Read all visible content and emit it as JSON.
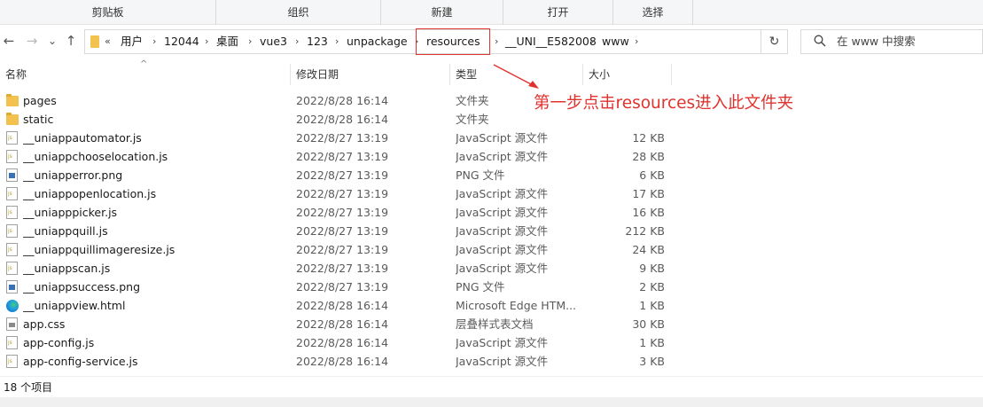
{
  "ribbon": {
    "groups": [
      "剪贴板",
      "组织",
      "新建",
      "打开",
      "选择"
    ]
  },
  "nav": {
    "back": "←",
    "forward": "→",
    "recent": "⌄",
    "up": "↑"
  },
  "address": {
    "overflow": "«",
    "crumbs": [
      "用户",
      "12044",
      "桌面",
      "vue3",
      "123",
      "unpackage",
      "resources",
      "__UNI__E582008",
      "www"
    ],
    "separator": "›",
    "highlight_color": "#e0332e"
  },
  "search": {
    "placeholder": "在 www 中搜索"
  },
  "columns": {
    "name": "名称",
    "date": "修改日期",
    "type": "类型",
    "size": "大小"
  },
  "files": [
    {
      "name": "pages",
      "date": "2022/8/28 16:14",
      "type": "文件夹",
      "size": "",
      "icon": "folder-icon"
    },
    {
      "name": "static",
      "date": "2022/8/28 16:14",
      "type": "文件夹",
      "size": "",
      "icon": "folder-icon"
    },
    {
      "name": "__uniappautomator.js",
      "date": "2022/8/27 13:19",
      "type": "JavaScript 源文件",
      "size": "12 KB",
      "icon": "js-file-icon"
    },
    {
      "name": "__uniappchooselocation.js",
      "date": "2022/8/27 13:19",
      "type": "JavaScript 源文件",
      "size": "28 KB",
      "icon": "js-file-icon"
    },
    {
      "name": "__uniapperror.png",
      "date": "2022/8/27 13:19",
      "type": "PNG 文件",
      "size": "6 KB",
      "icon": "png-file-icon"
    },
    {
      "name": "__uniappopenlocation.js",
      "date": "2022/8/27 13:19",
      "type": "JavaScript 源文件",
      "size": "17 KB",
      "icon": "js-file-icon"
    },
    {
      "name": "__uniapppicker.js",
      "date": "2022/8/27 13:19",
      "type": "JavaScript 源文件",
      "size": "16 KB",
      "icon": "js-file-icon"
    },
    {
      "name": "__uniappquill.js",
      "date": "2022/8/27 13:19",
      "type": "JavaScript 源文件",
      "size": "212 KB",
      "icon": "js-file-icon"
    },
    {
      "name": "__uniappquillimageresize.js",
      "date": "2022/8/27 13:19",
      "type": "JavaScript 源文件",
      "size": "24 KB",
      "icon": "js-file-icon"
    },
    {
      "name": "__uniappscan.js",
      "date": "2022/8/27 13:19",
      "type": "JavaScript 源文件",
      "size": "9 KB",
      "icon": "js-file-icon"
    },
    {
      "name": "__uniappsuccess.png",
      "date": "2022/8/27 13:19",
      "type": "PNG 文件",
      "size": "2 KB",
      "icon": "png-file-icon"
    },
    {
      "name": "__uniappview.html",
      "date": "2022/8/28 16:14",
      "type": "Microsoft Edge HTM...",
      "size": "1 KB",
      "icon": "edge-html-icon"
    },
    {
      "name": "app.css",
      "date": "2022/8/28 16:14",
      "type": "层叠样式表文档",
      "size": "30 KB",
      "icon": "css-file-icon"
    },
    {
      "name": "app-config.js",
      "date": "2022/8/28 16:14",
      "type": "JavaScript 源文件",
      "size": "1 KB",
      "icon": "js-file-icon"
    },
    {
      "name": "app-config-service.js",
      "date": "2022/8/28 16:14",
      "type": "JavaScript 源文件",
      "size": "3 KB",
      "icon": "js-file-icon"
    }
  ],
  "annotation": {
    "text": "第一步点击resources进入此文件夹",
    "color": "#e0332e"
  },
  "status": {
    "item_count": "18 个项目"
  }
}
